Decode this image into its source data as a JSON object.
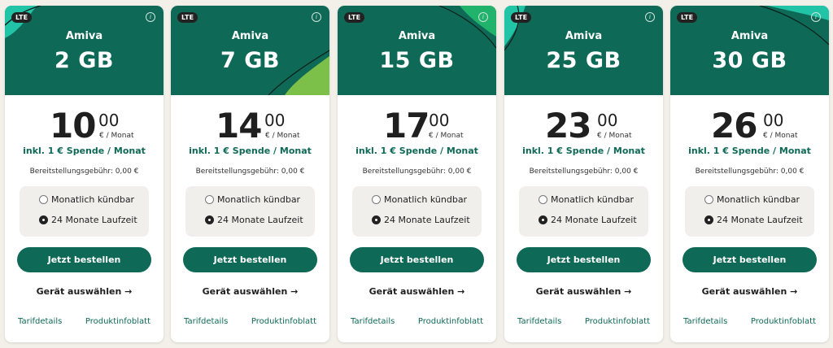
{
  "plans": [
    {
      "badge": "LTE",
      "brand": "Amiva",
      "volume": "2 GB",
      "price_main": "10",
      "price_cents": "00",
      "price_unit": "€ / Monat",
      "spende": "inkl. 1 € Spende / Monat",
      "fee": "Bereitstellungsgebühr:  0,00 €",
      "option_monthly": "Monatlich kündbar",
      "option_24": "24 Monate Laufzeit",
      "order_label": "Jetzt bestellen",
      "device_label": "Gerät auswählen →",
      "tarif_link": "Tarifdetails",
      "produkt_link": "Produktinfoblatt"
    },
    {
      "badge": "LTE",
      "brand": "Amiva",
      "volume": "7 GB",
      "price_main": "14",
      "price_cents": "00",
      "price_unit": "€ / Monat",
      "spende": "inkl. 1 € Spende / Monat",
      "fee": "Bereitstellungsgebühr:  0,00 €",
      "option_monthly": "Monatlich kündbar",
      "option_24": "24 Monate Laufzeit",
      "order_label": "Jetzt bestellen",
      "device_label": "Gerät auswählen →",
      "tarif_link": "Tarifdetails",
      "produkt_link": "Produktinfoblatt"
    },
    {
      "badge": "LTE",
      "brand": "Amiva",
      "volume": "15 GB",
      "price_main": "17",
      "price_cents": "00",
      "price_unit": "€ / Monat",
      "spende": "inkl. 1 € Spende / Monat",
      "fee": "Bereitstellungsgebühr:  0,00 €",
      "option_monthly": "Monatlich kündbar",
      "option_24": "24 Monate Laufzeit",
      "order_label": "Jetzt bestellen",
      "device_label": "Gerät auswählen →",
      "tarif_link": "Tarifdetails",
      "produkt_link": "Produktinfoblatt"
    },
    {
      "badge": "LTE",
      "brand": "Amiva",
      "volume": "25 GB",
      "price_main": "23",
      "price_cents": "00",
      "price_unit": "€ / Monat",
      "spende": "inkl. 1 € Spende / Monat",
      "fee": "Bereitstellungsgebühr:  0,00 €",
      "option_monthly": "Monatlich kündbar",
      "option_24": "24 Monate Laufzeit",
      "order_label": "Jetzt bestellen",
      "device_label": "Gerät auswählen →",
      "tarif_link": "Tarifdetails",
      "produkt_link": "Produktinfoblatt"
    },
    {
      "badge": "LTE",
      "brand": "Amiva",
      "volume": "30 GB",
      "price_main": "26",
      "price_cents": "00",
      "price_unit": "€ / Monat",
      "spende": "inkl. 1 € Spende / Monat",
      "fee": "Bereitstellungsgebühr:  0,00 €",
      "option_monthly": "Monatlich kündbar",
      "option_24": "24 Monate Laufzeit",
      "order_label": "Jetzt bestellen",
      "device_label": "Gerät auswählen →",
      "tarif_link": "Tarifdetails",
      "produkt_link": "Produktinfoblatt"
    }
  ],
  "selected_option": "24 Monate Laufzeit",
  "colors": {
    "brand_green": "#0f6957",
    "accent_green": "#7cc04a",
    "accent_teal": "#21c4a6",
    "background": "#f3f0ea"
  },
  "icons": {
    "info": "info-icon",
    "arrow": "arrow-right-icon"
  }
}
